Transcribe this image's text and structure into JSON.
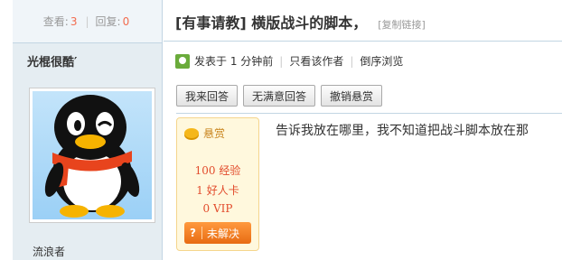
{
  "side": {
    "views_label": "查看:",
    "views_count": "3",
    "replies_label": "回复:",
    "replies_count": "0",
    "username": "光棍很酷′",
    "rank": "流浪者"
  },
  "post": {
    "title": "[有事请教] 横版战斗的脚本，",
    "copy_link": "[复制链接]",
    "posted_time": "发表于 1 分钟前",
    "only_author": "只看该作者",
    "reverse_order": "倒序浏览",
    "content": "告诉我放在哪里，我不知道把战斗脚本放在那"
  },
  "buttons": {
    "reply": "我来回答",
    "no_satisfying": "无满意回答",
    "cancel_bounty": "撤销悬赏"
  },
  "bounty": {
    "title": "悬赏",
    "experience": "100 经验",
    "good_card": "1 好人卡",
    "vip": "0 VIP",
    "status_icon": "?",
    "status": "未解决"
  },
  "colors": {
    "side_bg": "#e5edf2",
    "count": "#f26c4f",
    "bounty_text": "#e24b2c",
    "unsolved_bg": "#e86b13"
  }
}
